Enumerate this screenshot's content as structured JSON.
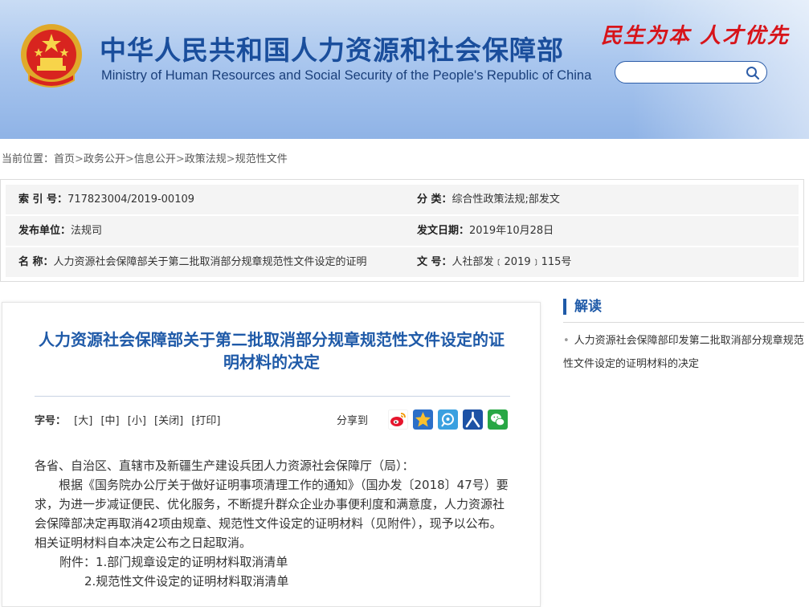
{
  "header": {
    "title_cn": "中华人民共和国人力资源和社会保障部",
    "title_en": "Ministry of Human Resources and Social Security of the People's Republic of China",
    "slogan": "民生为本 人才优先",
    "search_placeholder": ""
  },
  "breadcrumb": {
    "prefix": "当前位置：",
    "items": [
      "首页",
      "政务公开",
      "信息公开",
      "政策法规",
      "规范性文件"
    ],
    "separator": ">"
  },
  "meta": {
    "index_label": "索 引 号：",
    "index_value": "717823004/2019-00109",
    "category_label": "分    类：",
    "category_value": "综合性政策法规;部发文",
    "publisher_label": "发布单位：",
    "publisher_value": "法规司",
    "date_label": "发文日期：",
    "date_value": "2019年10月28日",
    "name_label": "名    称：",
    "name_value": "人力资源社会保障部关于第二批取消部分规章规范性文件设定的证明",
    "docno_label": "文    号：",
    "docno_value": "人社部发﹝2019﹞115号"
  },
  "article": {
    "title": "人力资源社会保障部关于第二批取消部分规章规范性文件设定的证明材料的决定",
    "fontsize_label": "字号：",
    "fontsize_options": [
      "[大]",
      "[中]",
      "[小]",
      "[关闭]",
      "[打印]"
    ],
    "share_label": "分享到",
    "share_icons": [
      "weibo-icon",
      "qzone-icon",
      "tencent-weibo-icon",
      "renmin-icon",
      "wechat-icon"
    ],
    "body": {
      "salutation": "各省、自治区、直辖市及新疆生产建设兵团人力资源社会保障厅（局）：",
      "paragraph": "根据《国务院办公厅关于做好证明事项清理工作的通知》（国办发〔2018〕47号）要求，为进一步减证便民、优化服务，不断提升群众企业办事便利度和满意度，人力资源社会保障部决定再取消42项由规章、规范性文件设定的证明材料（见附件），现予以公布。相关证明材料自本决定公布之日起取消。",
      "attachment_1": "附件：1.部门规章设定的证明材料取消清单",
      "attachment_2": "2.规范性文件设定的证明材料取消清单"
    }
  },
  "side": {
    "title": "解读",
    "items": [
      "人力资源社会保障部印发第二批取消部分规章规范性文件设定的证明材料的决定"
    ]
  },
  "colors": {
    "primary_blue": "#1f5aa8",
    "slogan_red": "#d7141a",
    "banner_blue": "#a9c6ee"
  }
}
